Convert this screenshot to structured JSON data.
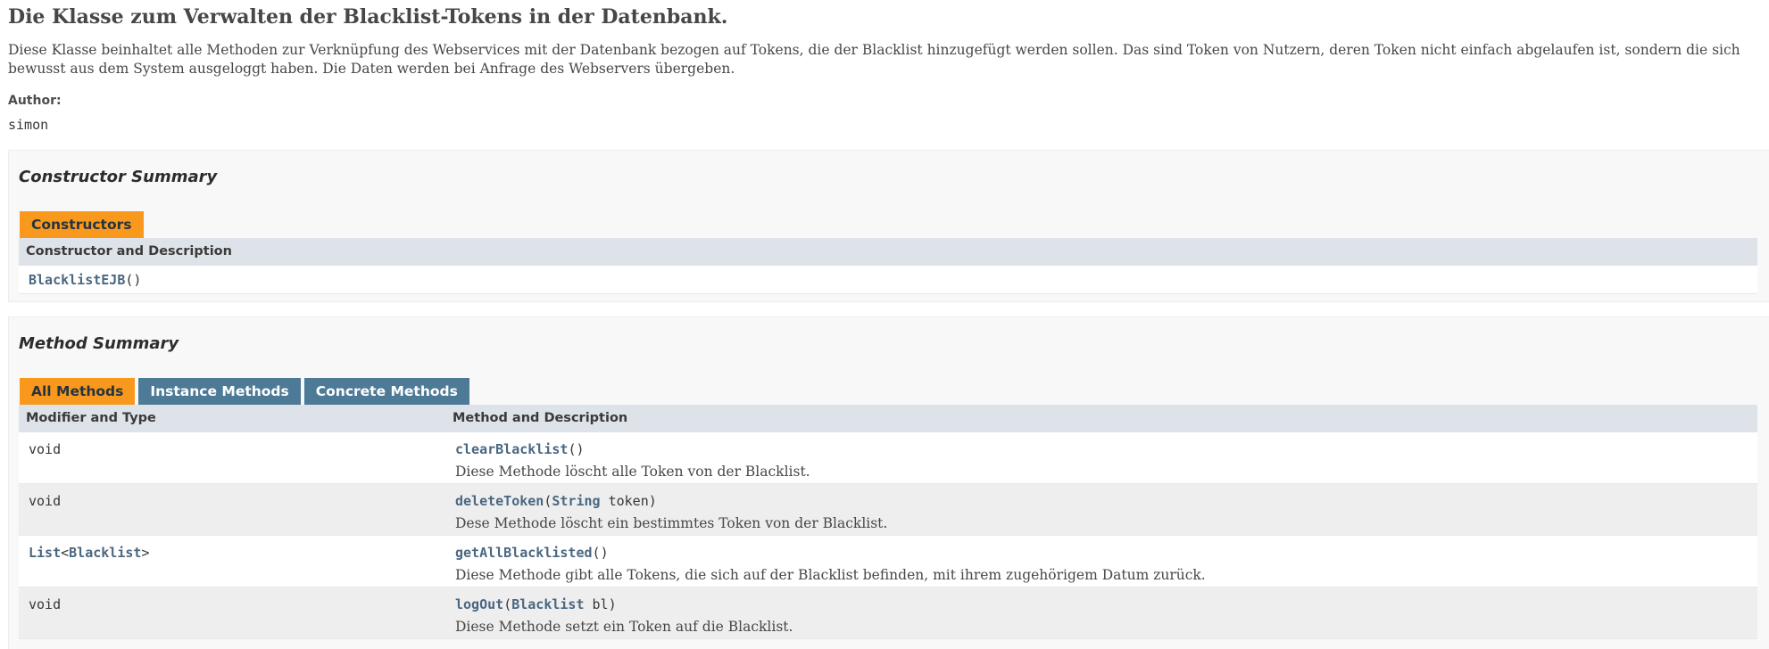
{
  "class_title": "Die Klasse zum Verwalten der Blacklist-Tokens in der Datenbank.",
  "description": "Diese Klasse beinhaltet alle Methoden zur Verknüpfung des Webservices mit der Datenbank bezogen auf Tokens, die der Blacklist hinzugefügt werden sollen. Das sind Token von Nutzern, deren Token nicht einfach abgelaufen ist, sondern die sich bewusst aus dem System ausgeloggt haben. Die Daten werden bei Anfrage des Webservers übergeben.",
  "author": {
    "label": "Author:",
    "value": "simon"
  },
  "constructor_summary": {
    "heading": "Constructor Summary",
    "tab": "Constructors",
    "column": "Constructor and Description",
    "rows": [
      {
        "name": "BlacklistEJB",
        "params": "()"
      }
    ]
  },
  "method_summary": {
    "heading": "Method Summary",
    "tabs": [
      "All Methods",
      "Instance Methods",
      "Concrete Methods"
    ],
    "columns": [
      "Modifier and Type",
      "Method and Description"
    ],
    "rows": [
      {
        "type": "void",
        "type_generic": "",
        "name": "clearBlacklist",
        "params_open": "(",
        "param_type": "",
        "param_rest": ")",
        "desc": "Diese Methode löscht alle Token von der Blacklist."
      },
      {
        "type": "void",
        "type_generic": "",
        "name": "deleteToken",
        "params_open": "(",
        "param_type": "String",
        "param_rest": " token)",
        "desc": "Dese Methode löscht ein bestimmtes Token von der Blacklist."
      },
      {
        "type": "List",
        "type_generic": "Blacklist",
        "name": "getAllBlacklisted",
        "params_open": "(",
        "param_type": "",
        "param_rest": ")",
        "desc": "Diese Methode gibt alle Tokens, die sich auf der Blacklist befinden, mit ihrem zugehörigem Datum zurück."
      },
      {
        "type": "void",
        "type_generic": "",
        "name": "logOut",
        "params_open": "(",
        "param_type": "Blacklist",
        "param_rest": " bl)",
        "desc": "Diese Methode setzt ein Token auf die Blacklist."
      }
    ]
  },
  "colors": {
    "accent_tab": "#f8981d",
    "inactive_tab": "#4d7a97",
    "link": "#4a6782",
    "header_row": "#dee3e9"
  }
}
